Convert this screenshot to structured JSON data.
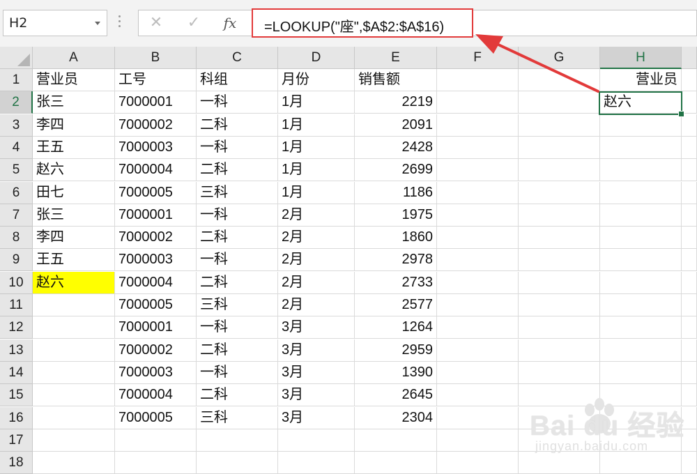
{
  "name_box": {
    "value": "H2"
  },
  "formula_bar": {
    "cancel_icon": "✕",
    "enter_icon": "✓",
    "fx_label": "fx",
    "formula": "=LOOKUP(\"座\",$A$2:$A$16)"
  },
  "columns": [
    "A",
    "B",
    "C",
    "D",
    "E",
    "F",
    "G",
    "H"
  ],
  "selected_column": "H",
  "selected_row": "2",
  "rows": [
    {
      "n": "1",
      "A": "营业员",
      "B": "工号",
      "C": "科组",
      "D": "月份",
      "E": "销售额",
      "H": "营业员"
    },
    {
      "n": "2",
      "A": "张三",
      "B": "7000001",
      "C": "一科",
      "D": "1月",
      "E": "2219",
      "H": "赵六"
    },
    {
      "n": "3",
      "A": "李四",
      "B": "7000002",
      "C": "二科",
      "D": "1月",
      "E": "2091"
    },
    {
      "n": "4",
      "A": "王五",
      "B": "7000003",
      "C": "一科",
      "D": "1月",
      "E": "2428"
    },
    {
      "n": "5",
      "A": "赵六",
      "B": "7000004",
      "C": "二科",
      "D": "1月",
      "E": "2699"
    },
    {
      "n": "6",
      "A": "田七",
      "B": "7000005",
      "C": "三科",
      "D": "1月",
      "E": "1186"
    },
    {
      "n": "7",
      "A": "张三",
      "B": "7000001",
      "C": "一科",
      "D": "2月",
      "E": "1975"
    },
    {
      "n": "8",
      "A": "李四",
      "B": "7000002",
      "C": "二科",
      "D": "2月",
      "E": "1860"
    },
    {
      "n": "9",
      "A": "王五",
      "B": "7000003",
      "C": "一科",
      "D": "2月",
      "E": "2978"
    },
    {
      "n": "10",
      "A": "赵六",
      "B": "7000004",
      "C": "二科",
      "D": "2月",
      "E": "2733"
    },
    {
      "n": "11",
      "A": "",
      "B": "7000005",
      "C": "三科",
      "D": "2月",
      "E": "2577"
    },
    {
      "n": "12",
      "A": "",
      "B": "7000001",
      "C": "一科",
      "D": "3月",
      "E": "1264"
    },
    {
      "n": "13",
      "A": "",
      "B": "7000002",
      "C": "二科",
      "D": "3月",
      "E": "2959"
    },
    {
      "n": "14",
      "A": "",
      "B": "7000003",
      "C": "一科",
      "D": "3月",
      "E": "1390"
    },
    {
      "n": "15",
      "A": "",
      "B": "7000004",
      "C": "二科",
      "D": "3月",
      "E": "2645"
    },
    {
      "n": "16",
      "A": "",
      "B": "7000005",
      "C": "三科",
      "D": "3月",
      "E": "2304"
    },
    {
      "n": "17"
    },
    {
      "n": "18"
    }
  ],
  "highlighted_cell": "A10",
  "highlight_color": "#ffff00",
  "accent_color": "#217346",
  "annotation_color": "#e23a3a",
  "watermark": {
    "brand": "Bai du 经验",
    "url": "jingyan.baidu.com"
  }
}
